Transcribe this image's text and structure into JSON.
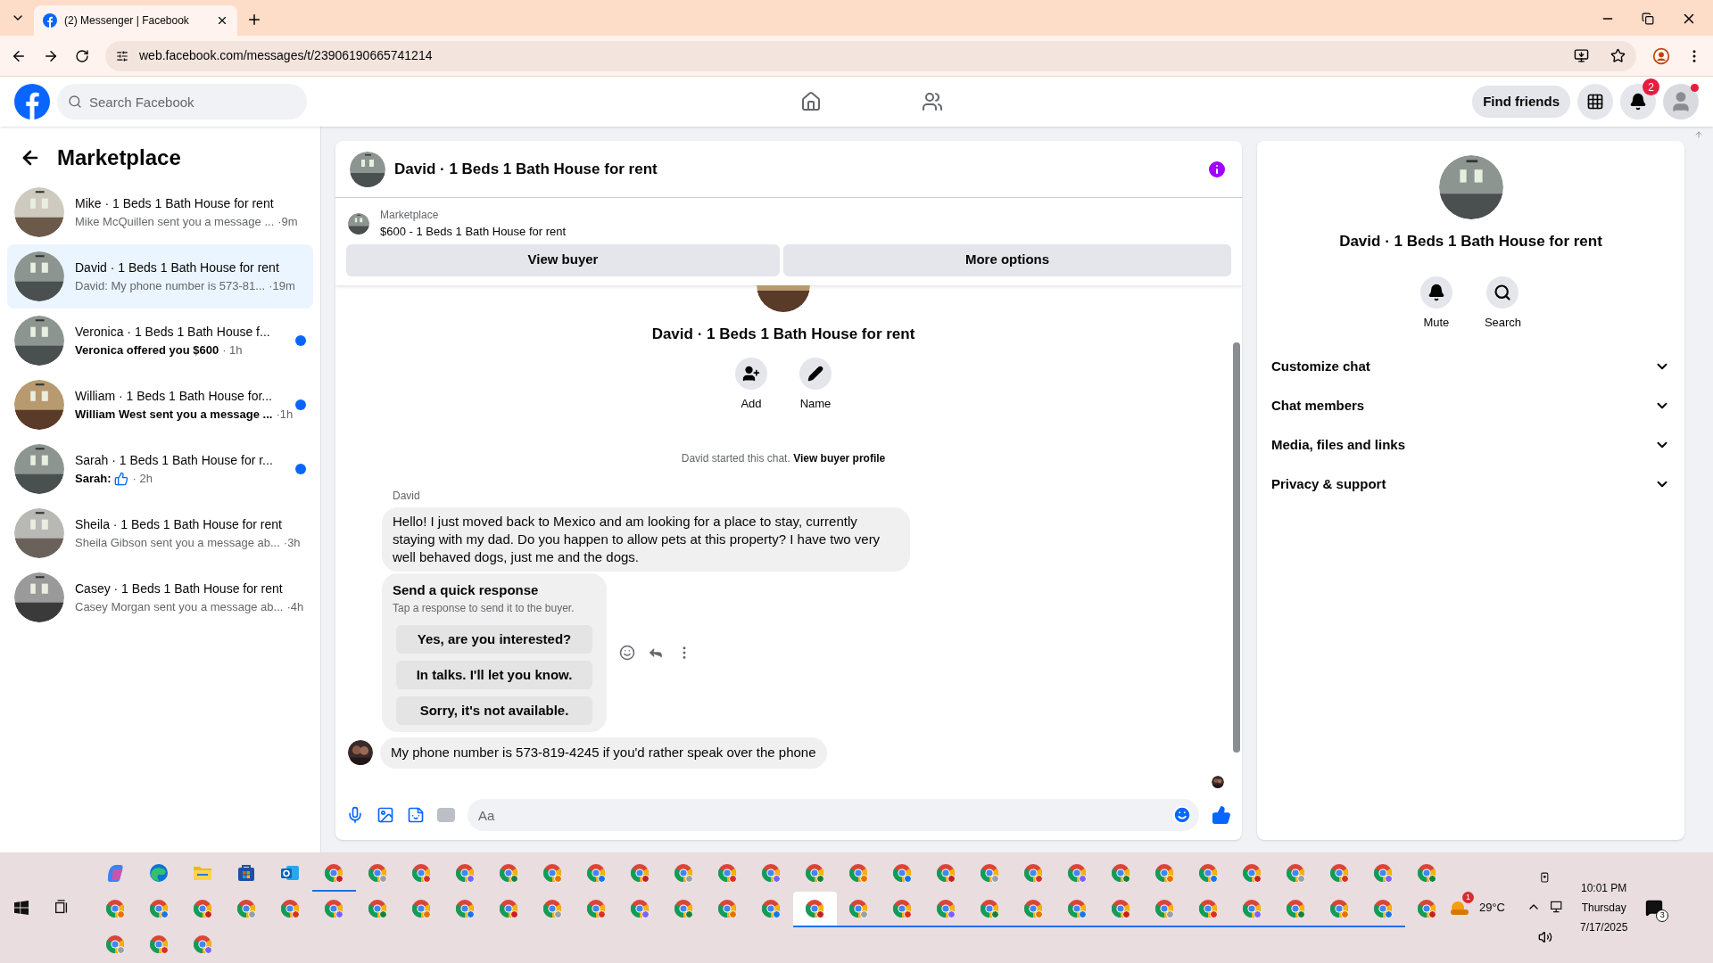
{
  "browser": {
    "tab_title": "(2) Messenger | Facebook",
    "url": "web.facebook.com/messages/t/23906190665741214"
  },
  "header": {
    "search_placeholder": "Search Facebook",
    "find_friends": "Find friends",
    "notification_count": "2"
  },
  "sidebar": {
    "title": "Marketplace",
    "conversations": [
      {
        "title": "Mike · 1 Beds 1 Bath House for rent",
        "preview": "Mike McQuillen sent you a message ...",
        "time": "·9m",
        "kind": "text",
        "selected": false,
        "unread": false
      },
      {
        "title": "David · 1 Beds 1 Bath House for rent",
        "preview": "David: My phone number is 573-81...",
        "time": "·19m",
        "kind": "text",
        "selected": true,
        "unread": false
      },
      {
        "title": "Veronica · 1 Beds 1 Bath House f...",
        "preview": "Veronica offered you $600",
        "time": "· 1h",
        "kind": "text",
        "selected": false,
        "unread": true
      },
      {
        "title": "William · 1 Beds 1 Bath House for...",
        "preview": "William West sent you a message ...",
        "time": "·1h",
        "kind": "text",
        "selected": false,
        "unread": true
      },
      {
        "title": "Sarah · 1 Beds 1 Bath House for r...",
        "preview": "Sarah:",
        "time": "· 2h",
        "kind": "like",
        "selected": false,
        "unread": true
      },
      {
        "title": "Sheila · 1 Beds 1 Bath House for rent",
        "preview": "Sheila Gibson sent you a message ab...",
        "time": "·3h",
        "kind": "text",
        "selected": false,
        "unread": false
      },
      {
        "title": "Casey · 1 Beds 1 Bath House for rent",
        "preview": "Casey Morgan sent you a message ab...",
        "time": "·4h",
        "kind": "text",
        "selected": false,
        "unread": false
      }
    ]
  },
  "chat": {
    "title": "David · 1 Beds 1 Bath House for rent",
    "listing_label": "Marketplace",
    "listing": "$600 - 1 Beds 1 Bath House for rent",
    "buttons": [
      "View buyer",
      "More options"
    ],
    "intro_title": "David · 1 Beds 1 Bath House for rent",
    "intro_actions": [
      {
        "label": "Add",
        "kind": "add"
      },
      {
        "label": "Name",
        "kind": "edit"
      }
    ],
    "started": "David started this chat.",
    "profile_link": "View buyer profile",
    "sender": "David",
    "message": "Hello! I just moved back to Mexico and am looking for a place to stay, currently staying with my dad. Do you happen to allow pets at this property? I have two very well behaved dogs, just me and the dogs.",
    "quick_title": "Send a quick response",
    "quick_subtitle": "Tap a response to send it to the buyer.",
    "quick_options": [
      "Yes, are you interested?",
      "In talks. I'll let you know.",
      "Sorry, it's not available."
    ],
    "last_message": "My phone number is 573-819-4245 if you'd rather speak over the phone",
    "composer_placeholder": "Aa"
  },
  "details": {
    "title": "David · 1 Beds 1 Bath House for rent",
    "actions": [
      {
        "label": "Mute",
        "kind": "mute"
      },
      {
        "label": "Search",
        "kind": "search"
      }
    ],
    "sections": [
      {
        "label": "Customize chat",
        "expanded": false
      },
      {
        "label": "Chat members",
        "expanded": false
      },
      {
        "label": "Media, files and links",
        "expanded": false
      },
      {
        "label": "Privacy & support",
        "expanded": false
      }
    ]
  },
  "taskbar": {
    "rows": [
      [
        {
          "kind": "copilot",
          "running": false,
          "selected": false
        },
        {
          "kind": "edge",
          "running": false,
          "selected": false
        },
        {
          "kind": "folder",
          "running": false,
          "selected": false
        },
        {
          "kind": "store",
          "running": false,
          "selected": false
        },
        {
          "kind": "outlook",
          "running": false,
          "selected": false
        },
        {
          "kind": "chrome",
          "running": true,
          "selected": false
        },
        {
          "kind": "chrome",
          "running": false,
          "selected": false
        },
        {
          "kind": "chrome",
          "running": false,
          "selected": false
        },
        {
          "kind": "chrome",
          "running": false,
          "selected": false
        },
        {
          "kind": "chrome",
          "running": false,
          "selected": false
        },
        {
          "kind": "chrome",
          "running": false,
          "selected": false
        },
        {
          "kind": "chrome",
          "running": false,
          "selected": false
        },
        {
          "kind": "chrome",
          "running": false,
          "selected": false
        },
        {
          "kind": "chrome",
          "running": false,
          "selected": false
        },
        {
          "kind": "chrome",
          "running": false,
          "selected": false
        },
        {
          "kind": "chrome",
          "running": false,
          "selected": false
        },
        {
          "kind": "chrome",
          "running": false,
          "selected": false
        },
        {
          "kind": "chrome",
          "running": false,
          "selected": false
        },
        {
          "kind": "chrome",
          "running": false,
          "selected": false
        },
        {
          "kind": "chrome",
          "running": false,
          "selected": false
        },
        {
          "kind": "chrome",
          "running": false,
          "selected": false
        },
        {
          "kind": "chrome",
          "running": false,
          "selected": false
        },
        {
          "kind": "chrome",
          "running": false,
          "selected": false
        },
        {
          "kind": "chrome",
          "running": false,
          "selected": false
        },
        {
          "kind": "chrome",
          "running": false,
          "selected": false
        },
        {
          "kind": "chrome",
          "running": false,
          "selected": false
        },
        {
          "kind": "chrome",
          "running": false,
          "selected": false
        },
        {
          "kind": "chrome",
          "running": false,
          "selected": false
        },
        {
          "kind": "chrome",
          "running": false,
          "selected": false
        },
        {
          "kind": "chrome",
          "running": false,
          "selected": false
        },
        {
          "kind": "chrome",
          "running": false,
          "selected": false
        }
      ],
      [
        {
          "kind": "chrome",
          "running": false,
          "selected": false
        },
        {
          "kind": "chrome",
          "running": false,
          "selected": false
        },
        {
          "kind": "chrome",
          "running": false,
          "selected": false
        },
        {
          "kind": "chrome",
          "running": false,
          "selected": false
        },
        {
          "kind": "chrome",
          "running": false,
          "selected": false
        },
        {
          "kind": "chrome",
          "running": false,
          "selected": false
        },
        {
          "kind": "chrome",
          "running": false,
          "selected": false
        },
        {
          "kind": "chrome",
          "running": false,
          "selected": false
        },
        {
          "kind": "chrome",
          "running": false,
          "selected": false
        },
        {
          "kind": "chrome",
          "running": false,
          "selected": false
        },
        {
          "kind": "chrome",
          "running": false,
          "selected": false
        },
        {
          "kind": "chrome",
          "running": false,
          "selected": false
        },
        {
          "kind": "chrome",
          "running": false,
          "selected": false
        },
        {
          "kind": "chrome",
          "running": false,
          "selected": false
        },
        {
          "kind": "chrome",
          "running": false,
          "selected": false
        },
        {
          "kind": "chrome",
          "running": false,
          "selected": false
        },
        {
          "kind": "chrome",
          "running": true,
          "selected": true
        },
        {
          "kind": "chrome",
          "running": true,
          "selected": false
        },
        {
          "kind": "chrome",
          "running": true,
          "selected": false
        },
        {
          "kind": "chrome",
          "running": true,
          "selected": false
        },
        {
          "kind": "chrome",
          "running": true,
          "selected": false
        },
        {
          "kind": "chrome",
          "running": true,
          "selected": false
        },
        {
          "kind": "chrome",
          "running": true,
          "selected": false
        },
        {
          "kind": "chrome",
          "running": true,
          "selected": false
        },
        {
          "kind": "chrome",
          "running": true,
          "selected": false
        },
        {
          "kind": "chrome",
          "running": true,
          "selected": false
        },
        {
          "kind": "chrome",
          "running": true,
          "selected": false
        },
        {
          "kind": "chrome",
          "running": true,
          "selected": false
        },
        {
          "kind": "chrome",
          "running": true,
          "selected": false
        },
        {
          "kind": "chrome",
          "running": true,
          "selected": false
        },
        {
          "kind": "chrome",
          "running": false,
          "selected": false
        }
      ],
      [
        {
          "kind": "chrome",
          "running": false,
          "selected": false
        },
        {
          "kind": "chrome",
          "running": false,
          "selected": false
        },
        {
          "kind": "chrome",
          "running": false,
          "selected": false
        }
      ]
    ],
    "weather_badge": "1",
    "temperature": "29°C",
    "time": "10:01 PM",
    "day": "Thursday",
    "date": "7/17/2025",
    "notification_count": "3"
  }
}
